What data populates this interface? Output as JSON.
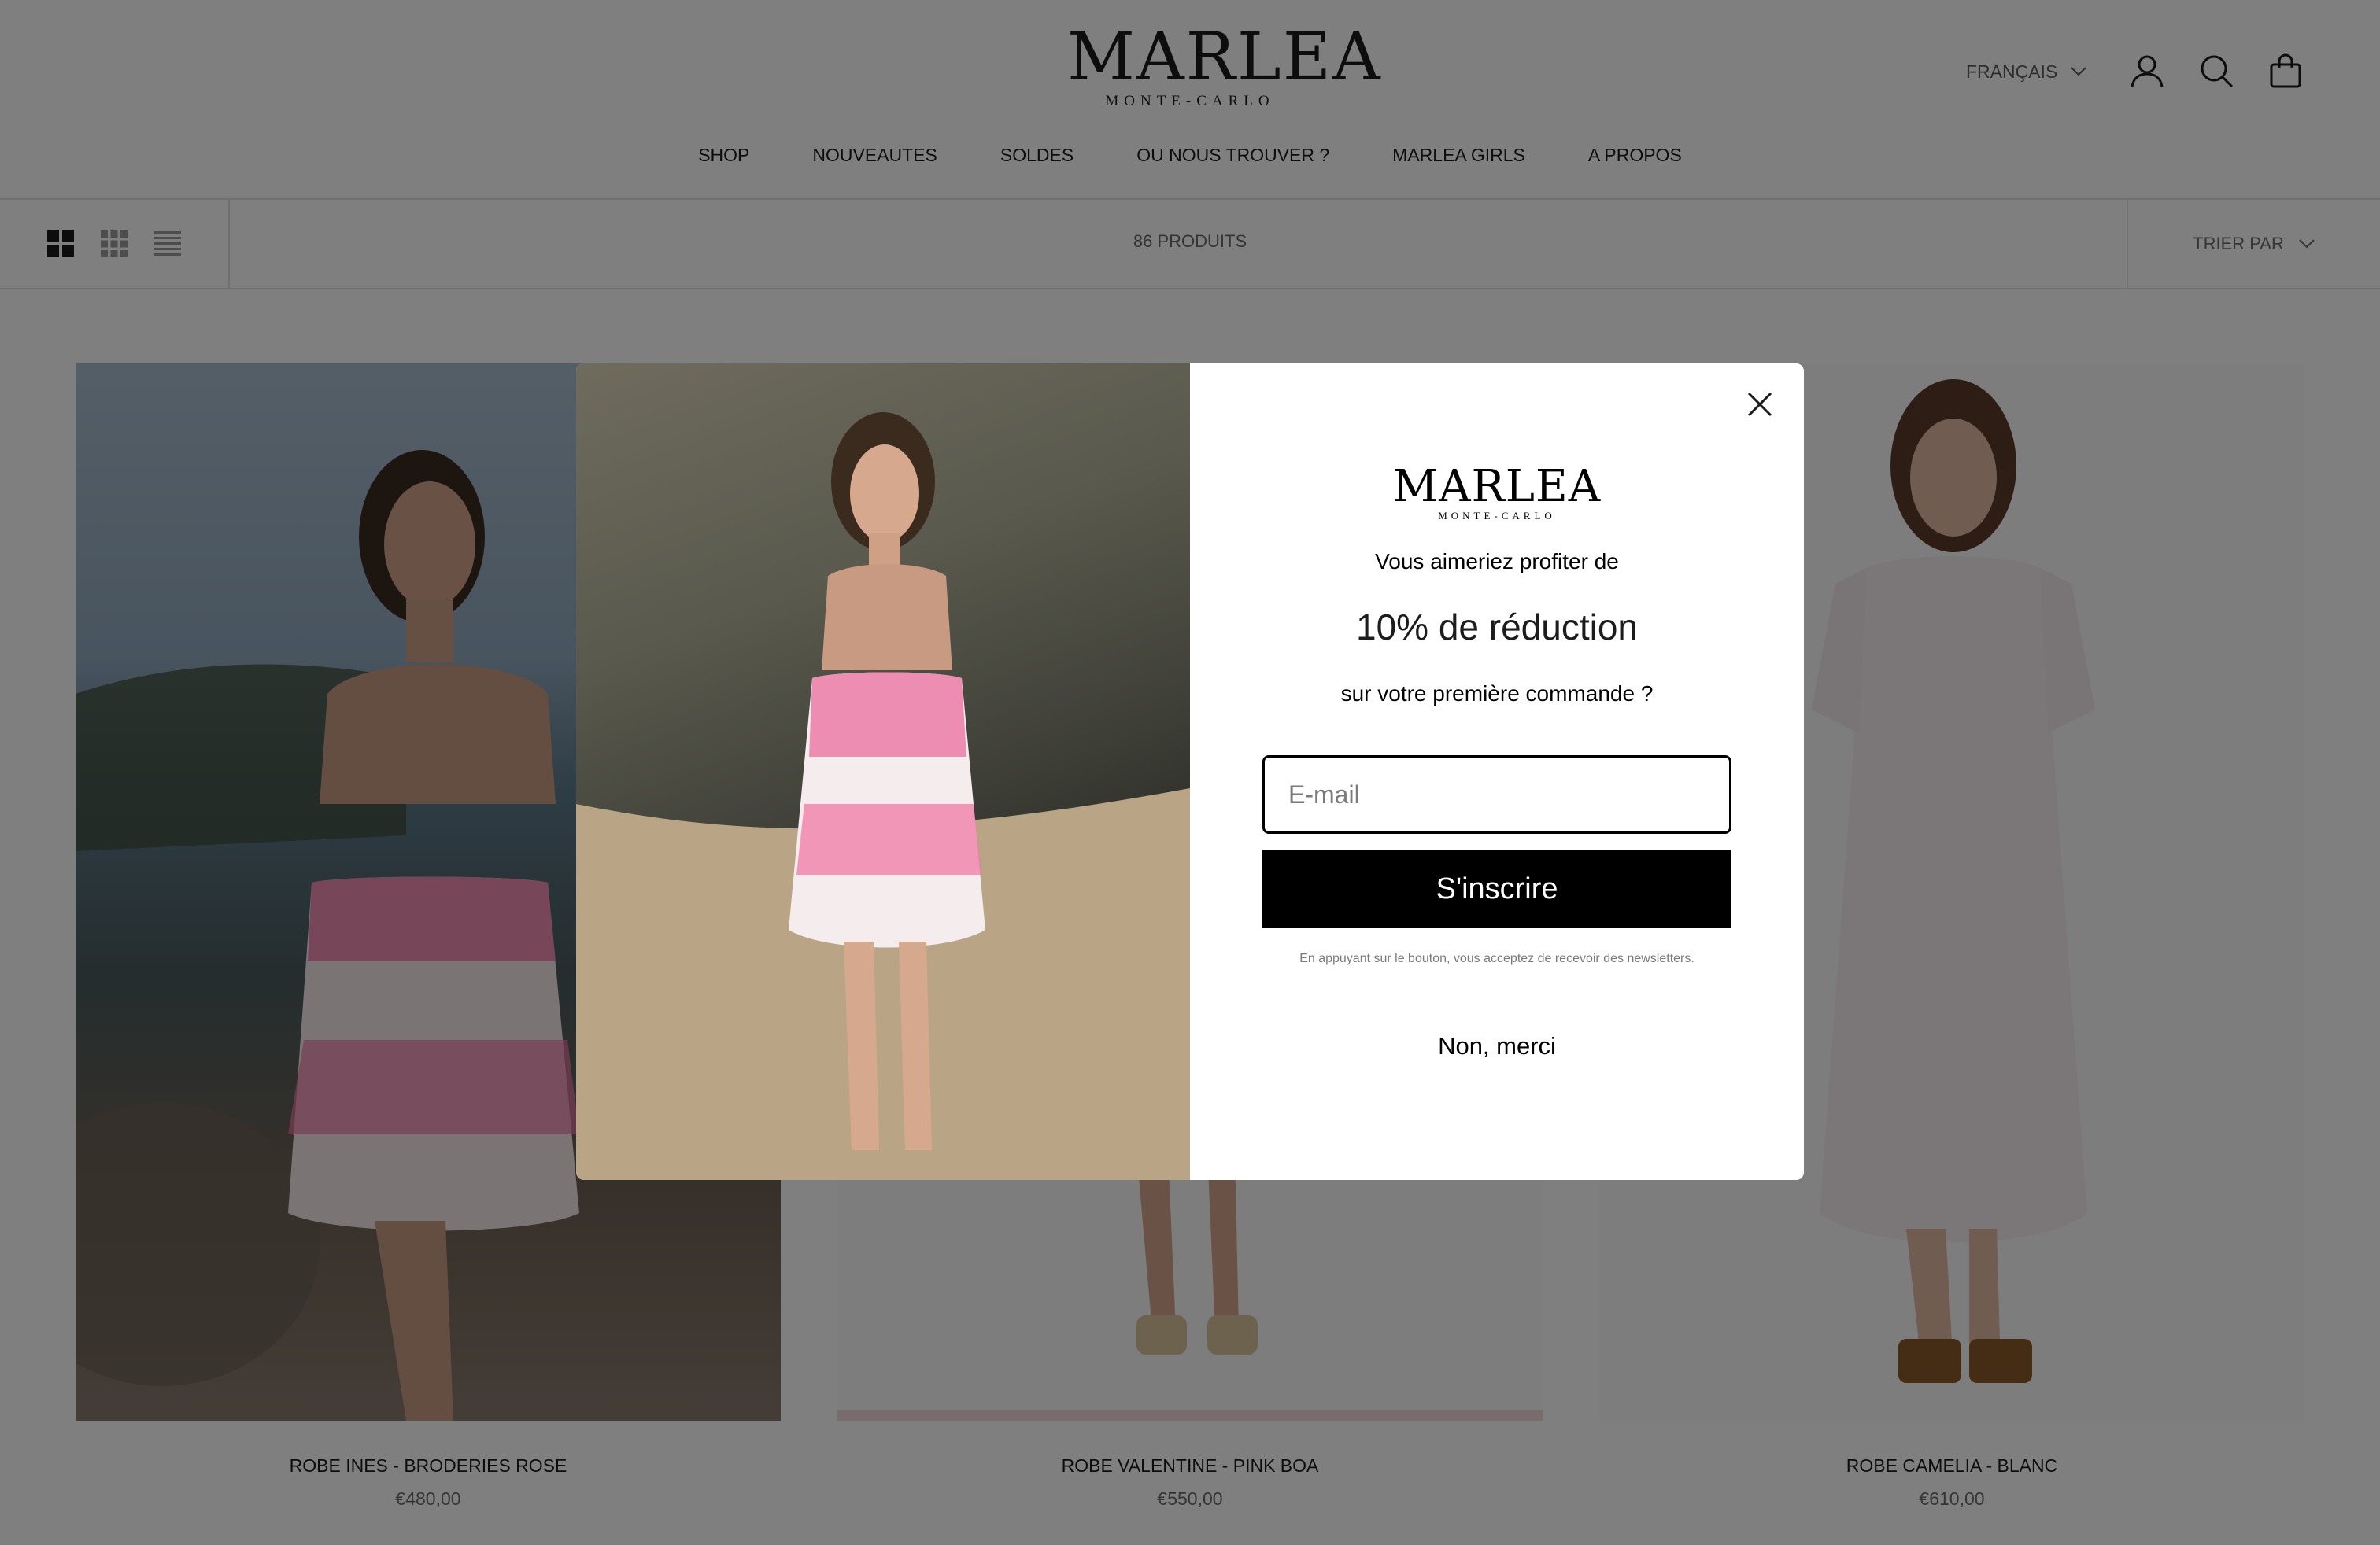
{
  "header": {
    "logo_main": "MARLEA",
    "logo_sub": "MONTE-CARLO",
    "language": "FRANÇAIS",
    "nav": [
      "SHOP",
      "NOUVEAUTES",
      "SOLDES",
      "OU NOUS TROUVER ?",
      "MARLEA GIRLS",
      "A PROPOS"
    ],
    "icons": [
      "account-icon",
      "search-icon",
      "bag-icon"
    ]
  },
  "toolbar": {
    "product_count": "86 PRODUITS",
    "sort_label": "TRIER PAR",
    "view_icons": [
      "grid-large-icon",
      "grid-small-icon",
      "list-icon"
    ]
  },
  "products": [
    {
      "title": "ROBE INES - BRODERIES ROSE",
      "price": "€480,00"
    },
    {
      "title": "ROBE VALENTINE - PINK BOA",
      "price": "€550,00"
    },
    {
      "title": "ROBE CAMELIA - BLANC",
      "price": "€610,00"
    }
  ],
  "popup": {
    "logo_main": "MARLEA",
    "logo_sub": "MONTE-CARLO",
    "line1": "Vous aimeriez profiter de",
    "headline": "10% de réduction",
    "line2": "sur votre première commande ?",
    "email_placeholder": "E-mail",
    "submit_label": "S'inscrire",
    "legal": "En appuyant sur le bouton, vous acceptez de recevoir des newsletters.",
    "decline_label": "Non, merci"
  },
  "colors": {
    "accent": "#000000",
    "overlay": "rgba(0,0,0,0.5)",
    "text_muted": "#6a6a6a"
  }
}
